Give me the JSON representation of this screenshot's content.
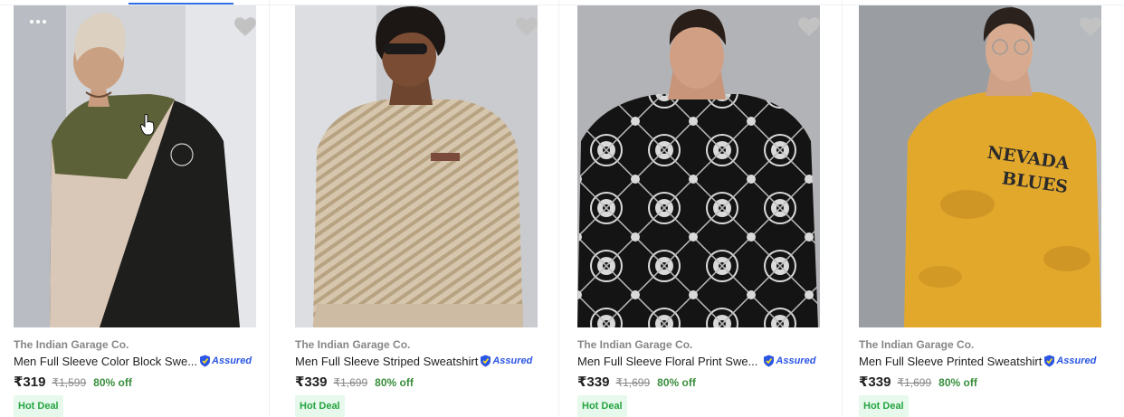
{
  "products": [
    {
      "brand": "The Indian Garage Co.",
      "title": "Men Full Sleeve Color Block Swe...",
      "assured": "Assured",
      "price": "₹319",
      "mrp": "₹1,599",
      "discount": "80% off",
      "badge": "Hot Deal",
      "image": "color-block-sweatshirt-photo"
    },
    {
      "brand": "The Indian Garage Co.",
      "title": "Men Full Sleeve Striped Sweatshirt",
      "assured": "Assured",
      "price": "₹339",
      "mrp": "₹1,699",
      "discount": "80% off",
      "badge": "Hot Deal",
      "image": "striped-sweatshirt-photo"
    },
    {
      "brand": "The Indian Garage Co.",
      "title": "Men Full Sleeve Floral Print Swe...",
      "assured": "Assured",
      "price": "₹339",
      "mrp": "₹1,699",
      "discount": "80% off",
      "badge": "Hot Deal",
      "image": "floral-print-sweatshirt-photo"
    },
    {
      "brand": "The Indian Garage Co.",
      "title": "Men Full Sleeve Printed Sweatshirt",
      "assured": "Assured",
      "price": "₹339",
      "mrp": "₹1,699",
      "discount": "80% off",
      "badge": "Hot Deal",
      "image": "nevada-blues-sweatshirt-photo",
      "print_text": "NEVADA BLUES"
    }
  ],
  "icons": {
    "wishlist": "heart-icon",
    "more": "more-options-icon",
    "assured": "assured-shield-icon",
    "cursor": "hand-pointer-icon"
  },
  "colors": {
    "price_discount": "#388e3c",
    "badge_bg": "#e6f9ec",
    "badge_text": "#26a541",
    "assured": "#2a55e5",
    "wishlist": "#c2c2c2"
  }
}
